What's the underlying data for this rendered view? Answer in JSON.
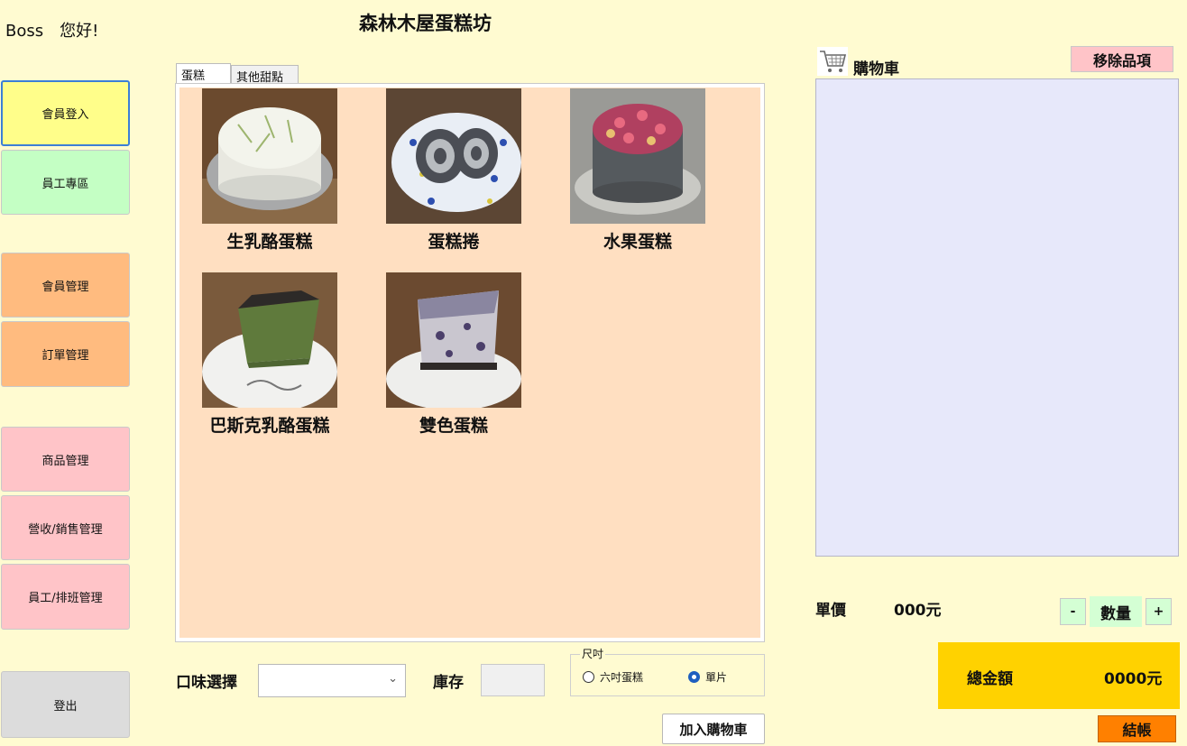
{
  "header": {
    "user": "Boss",
    "greeting": "您好!",
    "title": "森林木屋蛋糕坊"
  },
  "sidebar": {
    "items": [
      {
        "label": "會員登入",
        "color": "#fffe8a"
      },
      {
        "label": "員工專區",
        "color": "#c4ffc4"
      },
      {
        "label": "會員管理",
        "color": "#ffbb7f"
      },
      {
        "label": "訂單管理",
        "color": "#ffbb7f"
      },
      {
        "label": "商品管理",
        "color": "#ffc4c8"
      },
      {
        "label": "營收/銷售管理",
        "color": "#ffc4c8"
      },
      {
        "label": "員工/排班管理",
        "color": "#ffc4c8"
      },
      {
        "label": "登出",
        "color": "#dcdcdc"
      }
    ]
  },
  "tabs": [
    {
      "label": "蛋糕"
    },
    {
      "label": "其他甜點"
    }
  ],
  "products": [
    {
      "name": "生乳酪蛋糕",
      "icon": "cheesecake-photo"
    },
    {
      "name": "蛋糕捲",
      "icon": "cake-roll-photo"
    },
    {
      "name": "水果蛋糕",
      "icon": "fruit-cake-photo"
    },
    {
      "name": "巴斯克乳酪蛋糕",
      "icon": "basque-cheesecake-photo"
    },
    {
      "name": "雙色蛋糕",
      "icon": "two-tone-cake-photo"
    }
  ],
  "options": {
    "flavor_label": "口味選擇",
    "flavor_value": "",
    "stock_label": "庫存",
    "size_legend": "尺吋",
    "size_options": [
      {
        "label": "六吋蛋糕",
        "selected": false
      },
      {
        "label": "單片",
        "selected": true
      }
    ],
    "add_to_cart": "加入購物車"
  },
  "cart": {
    "label": "購物車",
    "remove": "移除品項",
    "unit_price_label": "單價",
    "unit_price": "000元",
    "qty_minus": "-",
    "qty_label": "數量",
    "qty_plus": "+",
    "total_label": "總金額",
    "total": "0000元",
    "checkout": "結帳"
  },
  "colors": {
    "background": "#fffbd1",
    "panel": "#ffdfc1",
    "cart_list": "#e7e8fa",
    "total": "#ffd200",
    "checkout": "#ff8000"
  }
}
